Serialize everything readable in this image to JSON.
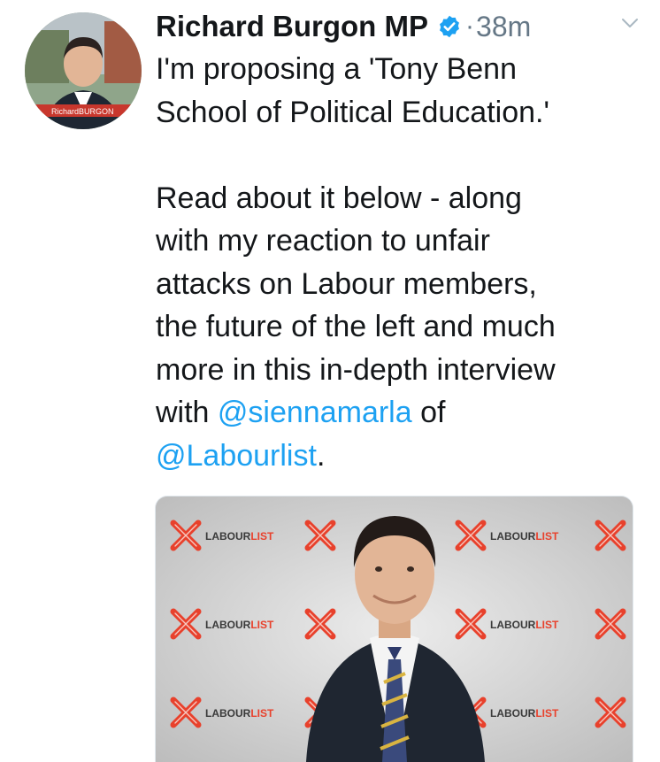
{
  "tweet": {
    "author_name": "Richard Burgon MP",
    "time_separator": "·",
    "time": "38m",
    "avatar_banner": "RichardBURGON",
    "line1": "I'm proposing a 'Tony Benn",
    "line2": "School of Political Education.'",
    "line3": "Read about it below - along",
    "line4": "with my reaction to unfair",
    "line5": "attacks on Labour members,",
    "line6": "the future of the left and much",
    "line7": "more in this in-depth interview",
    "line8_prefix": "with ",
    "mention1": "@siennamarla",
    "line8_suffix": " of",
    "mention2": "@Labourlist",
    "line9_suffix": "."
  },
  "card": {
    "brand_left": "LABOUR",
    "brand_right": "LIST"
  },
  "colors": {
    "link": "#1da1f2",
    "verified": "#1da1f2",
    "brand_red": "#e8412c",
    "text": "#14171a",
    "secondary": "#657786"
  },
  "icons": {
    "verified": "verified-badge-icon",
    "menu": "chevron-down-icon"
  }
}
